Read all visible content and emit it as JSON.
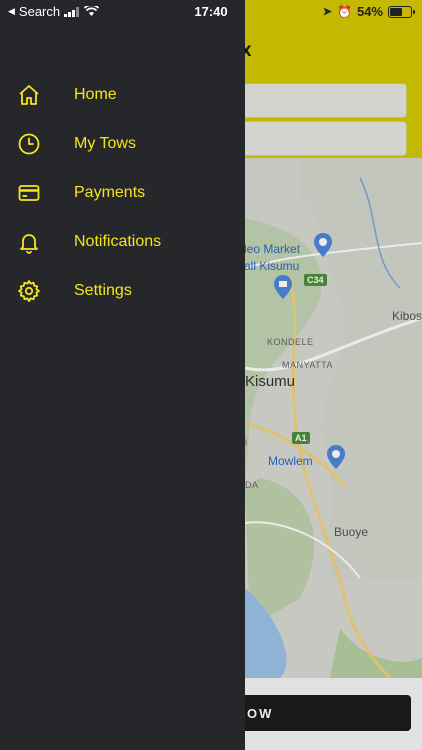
{
  "status_bar": {
    "back_label": "Search",
    "time": "17:40",
    "battery_percent": "54%",
    "battery_level": 0.54
  },
  "background": {
    "title_fragment": "e x",
    "button_fragment": "OW",
    "map_labels": {
      "market": "leo Market",
      "mall": "all Kisumu",
      "kondele": "KONDELE",
      "manyatta": "MANYATTA",
      "city": "Kisumu",
      "kibos": "Kibos",
      "mowlem": "Mowlem",
      "buoye": "Buoye",
      "road_c34": "C34",
      "road_a1": "A1",
      "frag_i": "i",
      "frag_da": "DA"
    }
  },
  "drawer": {
    "items": [
      {
        "label": "Home",
        "icon": "home-icon"
      },
      {
        "label": "My Tows",
        "icon": "clock-icon"
      },
      {
        "label": "Payments",
        "icon": "credit-card-icon"
      },
      {
        "label": "Notifications",
        "icon": "bell-icon"
      },
      {
        "label": "Settings",
        "icon": "gear-icon"
      }
    ]
  },
  "colors": {
    "accent": "#f5e51c",
    "drawer_bg": "#26272b",
    "header_bg": "#d5c800"
  }
}
